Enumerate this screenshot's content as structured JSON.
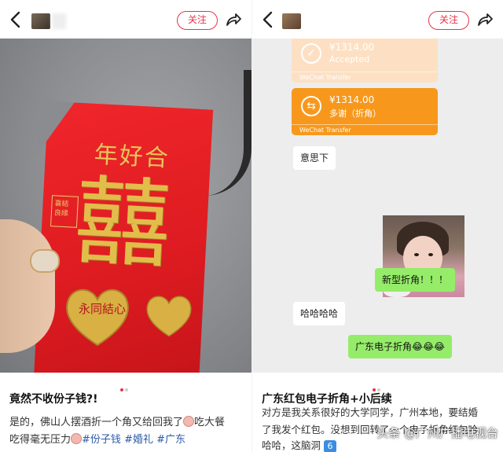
{
  "left_post": {
    "follow_label": "关注",
    "envelope": {
      "top_text": "年好合",
      "center_char": "囍",
      "stamp_text": "喜結良緣",
      "heart_text": "永同結心"
    },
    "title": "竟然不收份子钱?!",
    "body_line1": "是的，佛山人摆酒折一个角又给回我了",
    "body_line1_tail": "吃大餐",
    "body_line2_start": "吃得毫无压力",
    "tags": [
      "#份子钱",
      "#婚礼",
      "#广东"
    ]
  },
  "right_post": {
    "follow_label": "关注",
    "chat": {
      "transfer_accepted": {
        "amount": "¥1314.00",
        "status": "Accepted",
        "footer": "WeChat Transfer"
      },
      "transfer_sent": {
        "amount": "¥1314.00",
        "note": "多谢（折角）",
        "footer": "WeChat Transfer"
      },
      "msg1": "意思下",
      "msg2": "新型折角！！！",
      "msg3": "哈哈哈哈",
      "msg4": "广东电子折角"
    },
    "title": "广东红包电子折角+小后续",
    "body_line1": "对方是我关系很好的大学同学，广州本地，要结婚",
    "body_line2": "了我发个红包。没想到回转了一个电子折角红包哈",
    "body_line3": "哈哈，这脑洞",
    "badge": "6"
  },
  "watermark": "头条 @广州广播电视台",
  "colors": {
    "accent": "#e4344a",
    "wechat_green": "#95ec69",
    "transfer_orange": "#f7981d",
    "tag_blue": "#2a5aa8"
  }
}
